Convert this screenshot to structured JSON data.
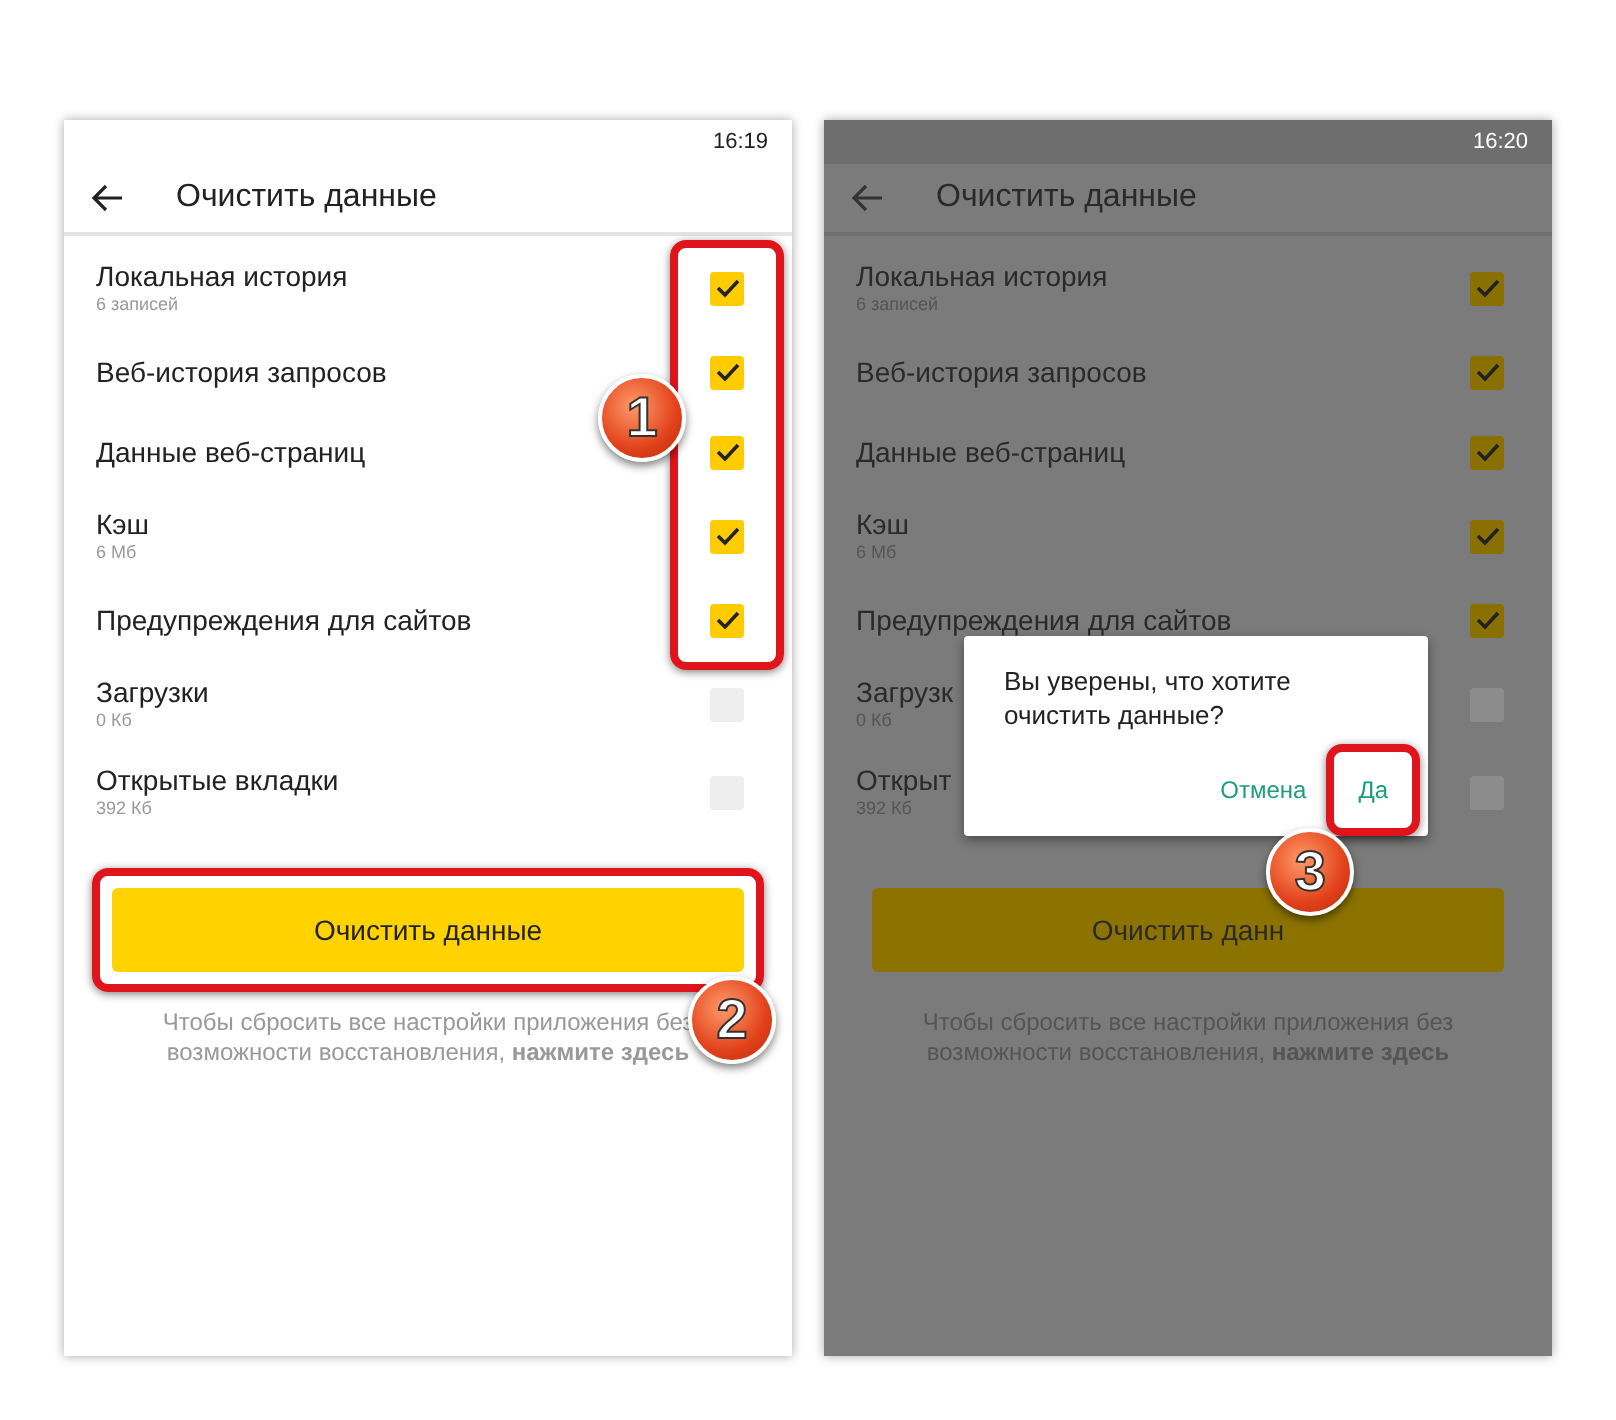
{
  "screens": [
    {
      "dimmed": false,
      "status_time": "16:19",
      "title": "Очистить данные",
      "items": [
        {
          "label": "Локальная история",
          "sublabel": "6 записей",
          "checked": true
        },
        {
          "label": "Веб-история запросов",
          "checked": true
        },
        {
          "label": "Данные веб-страниц",
          "checked": true
        },
        {
          "label": "Кэш",
          "sublabel": "6 Мб",
          "checked": true
        },
        {
          "label": "Предупреждения для сайтов",
          "checked": true
        },
        {
          "label": "Загрузки",
          "sublabel": "0 Кб",
          "checked": false
        },
        {
          "label": "Открытые вкладки",
          "sublabel": "392 Кб",
          "checked": false
        }
      ],
      "button": "Очистить данные",
      "hint": "Чтобы сбросить все настройки приложения без возможности восстановления, **нажмите здесь**",
      "callouts": [
        {
          "kind": "checkboxes",
          "number": "1"
        },
        {
          "kind": "button",
          "number": "2"
        }
      ]
    },
    {
      "dimmed": true,
      "status_time": "16:20",
      "title": "Очистить данные",
      "items": [
        {
          "label": "Локальная история",
          "sublabel": "6 записей",
          "checked": true
        },
        {
          "label": "Веб-история запросов",
          "checked": true
        },
        {
          "label": "Данные веб-страниц",
          "checked": true
        },
        {
          "label": "Кэш",
          "sublabel": "6 Мб",
          "checked": true
        },
        {
          "label": "Предупреждения для сайтов",
          "checked": true
        },
        {
          "label": "Загрузк",
          "sublabel": "0 Кб",
          "checked": false
        },
        {
          "label": "Открыт",
          "sublabel": "392 Кб",
          "checked": false
        }
      ],
      "button": "Очистить данн",
      "hint": "Чтобы сбросить все настройки приложения без возможности восстановления, **нажмите здесь**",
      "dialog": {
        "message": "Вы уверены, что хотите очистить данные?",
        "cancel": "Отмена",
        "confirm": "Да"
      },
      "callouts": [
        {
          "kind": "confirm",
          "number": "3"
        }
      ]
    }
  ]
}
